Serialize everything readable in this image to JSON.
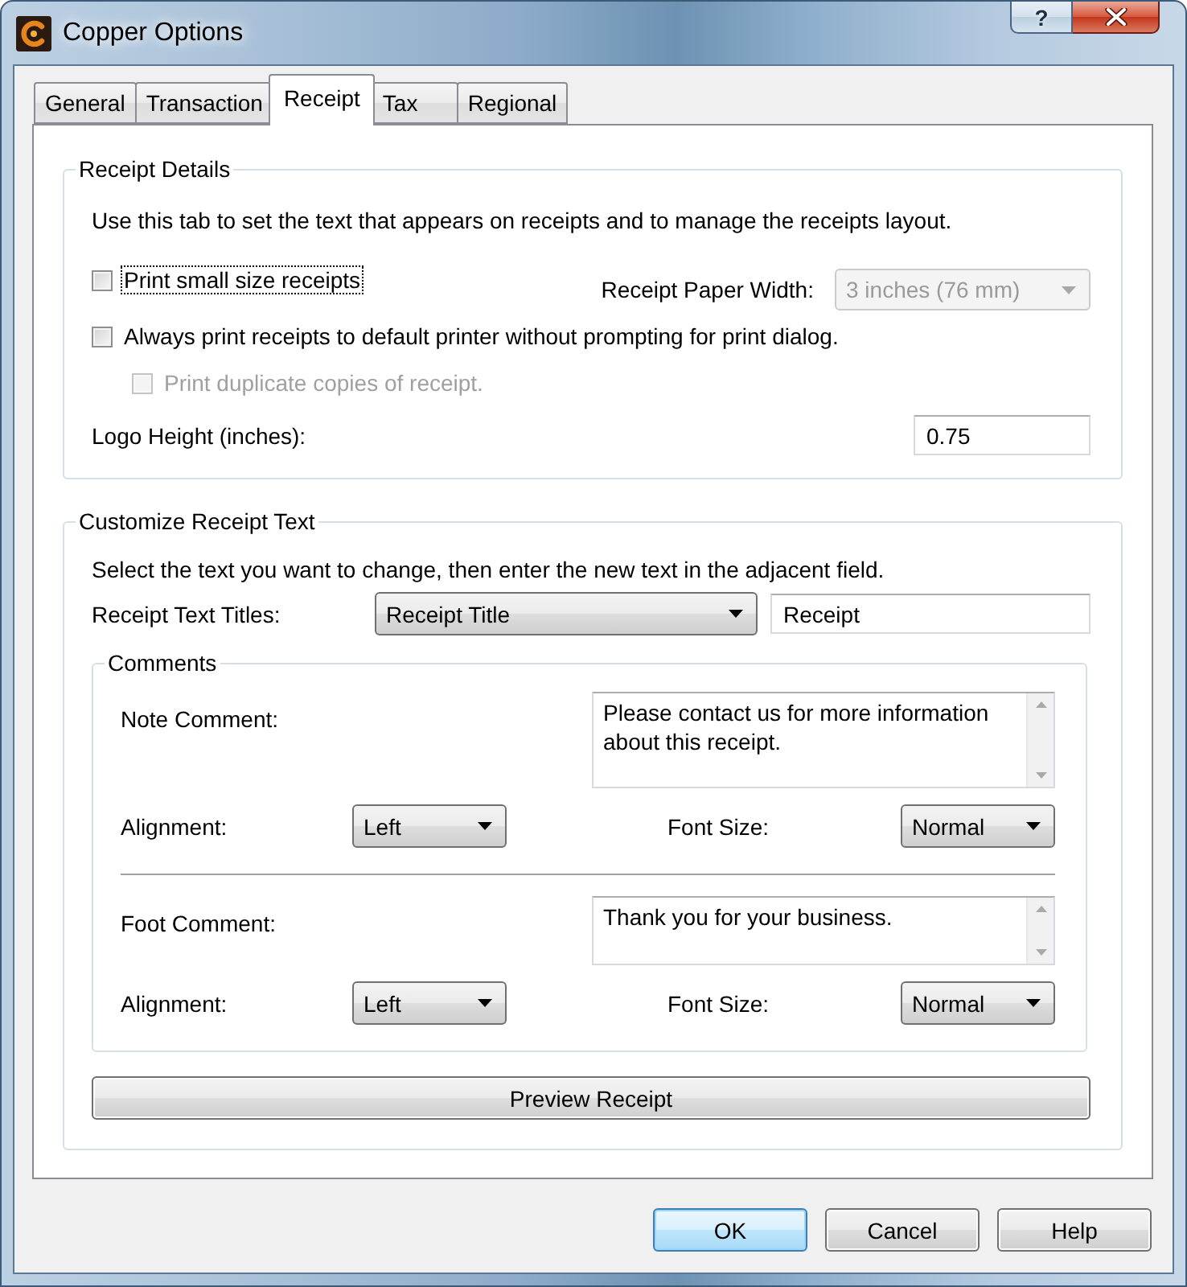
{
  "window": {
    "title": "Copper Options",
    "help_button": "?"
  },
  "tabs": [
    {
      "label": "General",
      "selected": false
    },
    {
      "label": "Transaction",
      "selected": false
    },
    {
      "label": "Receipt",
      "selected": true
    },
    {
      "label": "Tax",
      "selected": false
    },
    {
      "label": "Regional",
      "selected": false
    }
  ],
  "receipt_details": {
    "title": "Receipt Details",
    "description": "Use this tab to set the text that appears on receipts and to manage the receipts layout.",
    "small_receipts": {
      "label": "Print small size receipts",
      "checked": false,
      "disabled": false,
      "focused": true
    },
    "paper_width": {
      "label": "Receipt Paper Width:",
      "value": "3 inches (76 mm)",
      "disabled": true
    },
    "default_printer": {
      "label": "Always print receipts to default printer without prompting for print dialog.",
      "checked": false,
      "disabled": false,
      "focused": false,
      "children": [
        {
          "label": "Print duplicate copies of receipt.",
          "checked": false,
          "disabled": true,
          "focused": false
        }
      ]
    },
    "logo_height": {
      "label": "Logo Height (inches):",
      "value": "0.75"
    }
  },
  "customize_receipt_text": {
    "title": "Customize Receipt Text",
    "description": "Select the text you want to change, then enter the new text in the adjacent field.",
    "titles_label": "Receipt Text Titles:",
    "titles_select": "Receipt Title",
    "title_text": "Receipt",
    "comments": {
      "title": "Comments",
      "items": [
        {
          "label": "Note Comment:",
          "text": "Please contact us for more information about this receipt.",
          "alignment_label": "Alignment:",
          "alignment": "Left",
          "font_size_label": "Font Size:",
          "font_size": "Normal"
        },
        {
          "label": "Foot Comment:",
          "text": "Thank you for your business.",
          "alignment_label": "Alignment:",
          "alignment": "Left",
          "font_size_label": "Font Size:",
          "font_size": "Normal"
        }
      ]
    },
    "preview_button": "Preview Receipt"
  },
  "buttons": [
    {
      "label": "OK",
      "default": true
    },
    {
      "label": "Cancel",
      "default": false
    },
    {
      "label": "Help",
      "default": false
    }
  ]
}
